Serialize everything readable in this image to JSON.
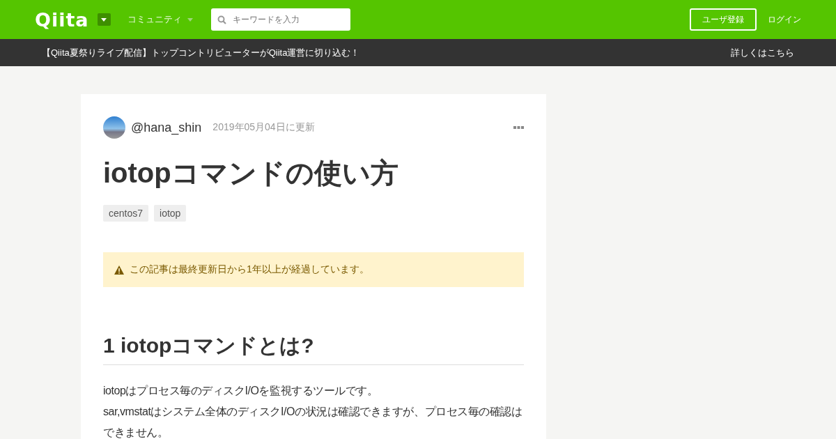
{
  "header": {
    "logo": "Qiita",
    "community": "コミュニティ",
    "search": {
      "placeholder": "キーワードを入力"
    },
    "signup": "ユーザ登録",
    "login": "ログイン"
  },
  "banner": {
    "text": "【Qiita夏祭りライブ配信】トップコントリビューターがQiita運営に切り込む！",
    "link": "詳しくはこちら"
  },
  "article": {
    "author": "@hana_shin",
    "updated": "2019年05月04日に更新",
    "title": "iotopコマンドの使い方",
    "tags": [
      "centos7",
      "iotop"
    ],
    "notice": "この記事は最終更新日から1年以上が経過しています。",
    "heading": "1 iotopコマンドとは?",
    "lines": [
      "iotopはプロセス毎のディスクI/Oを監視するツールです。",
      "sar,vmstatはシステム全体のディスクI/Oの状況は確認できますが、プロセス毎の確認はできません。"
    ]
  }
}
